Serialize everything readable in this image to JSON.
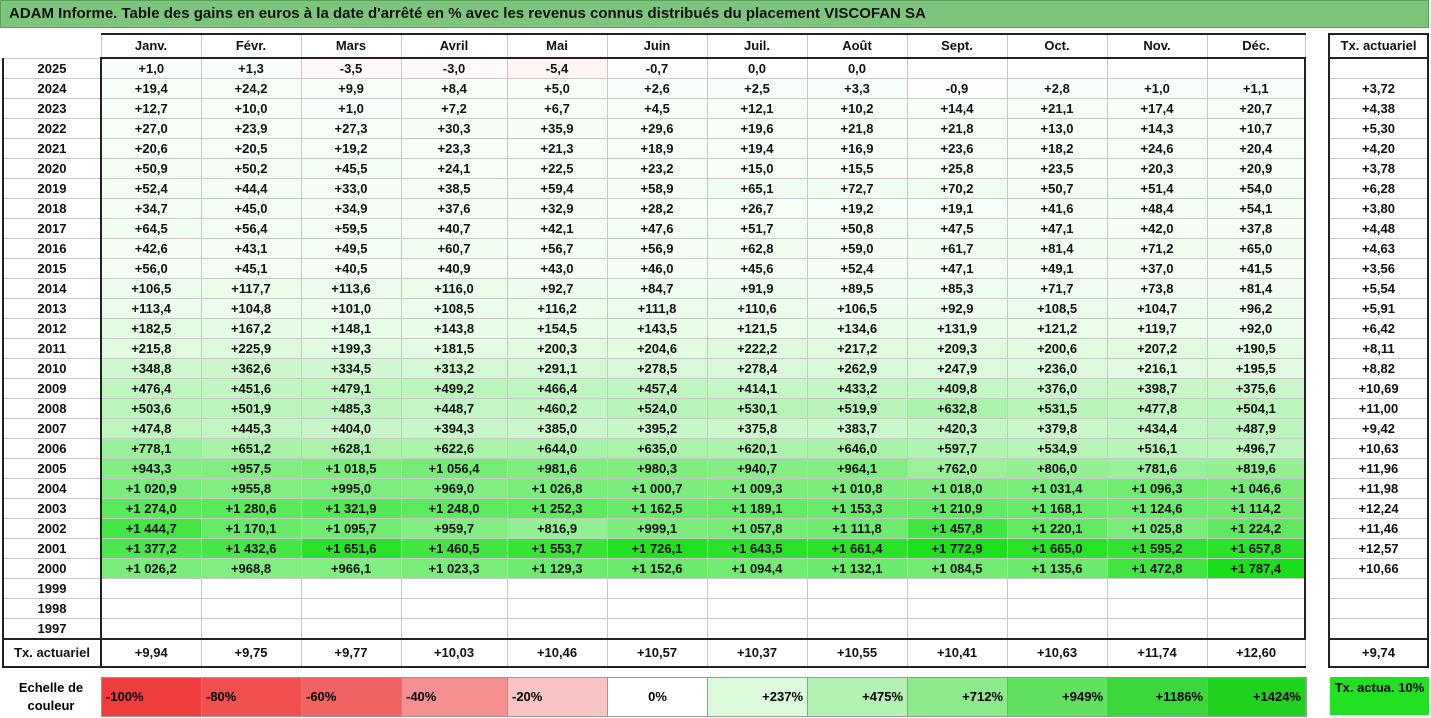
{
  "title": "ADAM Informe. Table des gains en euros à la date d'arrêté en % avec les revenus connus distribués du placement VISCOFAN SA",
  "months": [
    "Janv.",
    "Févr.",
    "Mars",
    "Avril",
    "Mai",
    "Juin",
    "Juil.",
    "Août",
    "Sept.",
    "Oct.",
    "Nov.",
    "Déc."
  ],
  "tx_header": "Tx. actuariel",
  "rows": [
    {
      "year": "2025",
      "values": [
        "+1,0",
        "+1,3",
        "-3,5",
        "-3,0",
        "-5,4",
        "-0,7",
        "0,0",
        "0,0",
        "",
        "",
        "",
        ""
      ],
      "tx": ""
    },
    {
      "year": "2024",
      "values": [
        "+19,4",
        "+24,2",
        "+9,9",
        "+8,4",
        "+5,0",
        "+2,6",
        "+2,5",
        "+3,3",
        "-0,9",
        "+2,8",
        "+1,0",
        "+1,1"
      ],
      "tx": "+3,72"
    },
    {
      "year": "2023",
      "values": [
        "+12,7",
        "+10,0",
        "+1,0",
        "+7,2",
        "+6,7",
        "+4,5",
        "+12,1",
        "+10,2",
        "+14,4",
        "+21,1",
        "+17,4",
        "+20,7"
      ],
      "tx": "+4,38"
    },
    {
      "year": "2022",
      "values": [
        "+27,0",
        "+23,9",
        "+27,3",
        "+30,3",
        "+35,9",
        "+29,6",
        "+19,6",
        "+21,8",
        "+21,8",
        "+13,0",
        "+14,3",
        "+10,7"
      ],
      "tx": "+5,30"
    },
    {
      "year": "2021",
      "values": [
        "+20,6",
        "+20,5",
        "+19,2",
        "+23,3",
        "+21,3",
        "+18,9",
        "+19,4",
        "+16,9",
        "+23,6",
        "+18,2",
        "+24,6",
        "+20,4"
      ],
      "tx": "+4,20"
    },
    {
      "year": "2020",
      "values": [
        "+50,9",
        "+50,2",
        "+45,5",
        "+24,1",
        "+22,5",
        "+23,2",
        "+15,0",
        "+15,5",
        "+25,8",
        "+23,5",
        "+20,3",
        "+20,9"
      ],
      "tx": "+3,78"
    },
    {
      "year": "2019",
      "values": [
        "+52,4",
        "+44,4",
        "+33,0",
        "+38,5",
        "+59,4",
        "+58,9",
        "+65,1",
        "+72,7",
        "+70,2",
        "+50,7",
        "+51,4",
        "+54,0"
      ],
      "tx": "+6,28"
    },
    {
      "year": "2018",
      "values": [
        "+34,7",
        "+45,0",
        "+34,9",
        "+37,6",
        "+32,9",
        "+28,2",
        "+26,7",
        "+19,2",
        "+19,1",
        "+41,6",
        "+48,4",
        "+54,1"
      ],
      "tx": "+3,80"
    },
    {
      "year": "2017",
      "values": [
        "+64,5",
        "+56,4",
        "+59,5",
        "+40,7",
        "+42,1",
        "+47,6",
        "+51,7",
        "+50,8",
        "+47,5",
        "+47,1",
        "+42,0",
        "+37,8"
      ],
      "tx": "+4,48"
    },
    {
      "year": "2016",
      "values": [
        "+42,6",
        "+43,1",
        "+49,5",
        "+60,7",
        "+56,7",
        "+56,9",
        "+62,8",
        "+59,0",
        "+61,7",
        "+81,4",
        "+71,2",
        "+65,0"
      ],
      "tx": "+4,63"
    },
    {
      "year": "2015",
      "values": [
        "+56,0",
        "+45,1",
        "+40,5",
        "+40,9",
        "+43,0",
        "+46,0",
        "+45,6",
        "+52,4",
        "+47,1",
        "+49,1",
        "+37,0",
        "+41,5"
      ],
      "tx": "+3,56"
    },
    {
      "year": "2014",
      "values": [
        "+106,5",
        "+117,7",
        "+113,6",
        "+116,0",
        "+92,7",
        "+84,7",
        "+91,9",
        "+89,5",
        "+85,3",
        "+71,7",
        "+73,8",
        "+81,4"
      ],
      "tx": "+5,54"
    },
    {
      "year": "2013",
      "values": [
        "+113,4",
        "+104,8",
        "+101,0",
        "+108,5",
        "+116,2",
        "+111,8",
        "+110,6",
        "+106,5",
        "+92,9",
        "+108,5",
        "+104,7",
        "+96,2"
      ],
      "tx": "+5,91"
    },
    {
      "year": "2012",
      "values": [
        "+182,5",
        "+167,2",
        "+148,1",
        "+143,8",
        "+154,5",
        "+143,5",
        "+121,5",
        "+134,6",
        "+131,9",
        "+121,2",
        "+119,7",
        "+92,0"
      ],
      "tx": "+6,42"
    },
    {
      "year": "2011",
      "values": [
        "+215,8",
        "+225,9",
        "+199,3",
        "+181,5",
        "+200,3",
        "+204,6",
        "+222,2",
        "+217,2",
        "+209,3",
        "+200,6",
        "+207,2",
        "+190,5"
      ],
      "tx": "+8,11"
    },
    {
      "year": "2010",
      "values": [
        "+348,8",
        "+362,6",
        "+334,5",
        "+313,2",
        "+291,1",
        "+278,5",
        "+278,4",
        "+262,9",
        "+247,9",
        "+236,0",
        "+216,1",
        "+195,5"
      ],
      "tx": "+8,82"
    },
    {
      "year": "2009",
      "values": [
        "+476,4",
        "+451,6",
        "+479,1",
        "+499,2",
        "+466,4",
        "+457,4",
        "+414,1",
        "+433,2",
        "+409,8",
        "+376,0",
        "+398,7",
        "+375,6"
      ],
      "tx": "+10,69"
    },
    {
      "year": "2008",
      "values": [
        "+503,6",
        "+501,9",
        "+485,3",
        "+448,7",
        "+460,2",
        "+524,0",
        "+530,1",
        "+519,9",
        "+632,8",
        "+531,5",
        "+477,8",
        "+504,1"
      ],
      "tx": "+11,00"
    },
    {
      "year": "2007",
      "values": [
        "+474,8",
        "+445,3",
        "+404,0",
        "+394,3",
        "+385,0",
        "+395,2",
        "+375,8",
        "+383,7",
        "+420,3",
        "+379,8",
        "+434,4",
        "+487,9"
      ],
      "tx": "+9,42"
    },
    {
      "year": "2006",
      "values": [
        "+778,1",
        "+651,2",
        "+628,1",
        "+622,6",
        "+644,0",
        "+635,0",
        "+620,1",
        "+646,0",
        "+597,7",
        "+534,9",
        "+516,1",
        "+496,7"
      ],
      "tx": "+10,63"
    },
    {
      "year": "2005",
      "values": [
        "+943,3",
        "+957,5",
        "+1 018,5",
        "+1 056,4",
        "+981,6",
        "+980,3",
        "+940,7",
        "+964,1",
        "+762,0",
        "+806,0",
        "+781,6",
        "+819,6"
      ],
      "tx": "+11,96"
    },
    {
      "year": "2004",
      "values": [
        "+1 020,9",
        "+955,8",
        "+995,0",
        "+969,0",
        "+1 026,8",
        "+1 000,7",
        "+1 009,3",
        "+1 010,8",
        "+1 018,0",
        "+1 031,4",
        "+1 096,3",
        "+1 046,6"
      ],
      "tx": "+11,98"
    },
    {
      "year": "2003",
      "values": [
        "+1 274,0",
        "+1 280,6",
        "+1 321,9",
        "+1 248,0",
        "+1 252,3",
        "+1 162,5",
        "+1 189,1",
        "+1 153,3",
        "+1 210,9",
        "+1 168,1",
        "+1 124,6",
        "+1 114,2"
      ],
      "tx": "+12,24"
    },
    {
      "year": "2002",
      "values": [
        "+1 444,7",
        "+1 170,1",
        "+1 095,7",
        "+959,7",
        "+816,9",
        "+999,1",
        "+1 057,8",
        "+1 111,8",
        "+1 457,8",
        "+1 220,1",
        "+1 025,8",
        "+1 224,2"
      ],
      "tx": "+11,46"
    },
    {
      "year": "2001",
      "values": [
        "+1 377,2",
        "+1 432,6",
        "+1 651,6",
        "+1 460,5",
        "+1 553,7",
        "+1 726,1",
        "+1 643,5",
        "+1 661,4",
        "+1 772,9",
        "+1 665,0",
        "+1 595,2",
        "+1 657,8"
      ],
      "tx": "+12,57"
    },
    {
      "year": "2000",
      "values": [
        "+1 026,2",
        "+968,8",
        "+966,1",
        "+1 023,3",
        "+1 129,3",
        "+1 152,6",
        "+1 094,4",
        "+1 132,1",
        "+1 084,5",
        "+1 135,6",
        "+1 472,8",
        "+1 787,4"
      ],
      "tx": "+10,66"
    },
    {
      "year": "1999",
      "values": [
        "",
        "",
        "",
        "",
        "",
        "",
        "",
        "",
        "",
        "",
        "",
        ""
      ],
      "tx": ""
    },
    {
      "year": "1998",
      "values": [
        "",
        "",
        "",
        "",
        "",
        "",
        "",
        "",
        "",
        "",
        "",
        ""
      ],
      "tx": ""
    },
    {
      "year": "1997",
      "values": [
        "",
        "",
        "",
        "",
        "",
        "",
        "",
        "",
        "",
        "",
        "",
        ""
      ],
      "tx": ""
    }
  ],
  "footer": {
    "label": "Tx. actuariel",
    "values": [
      "+9,94",
      "+9,75",
      "+9,77",
      "+10,03",
      "+10,46",
      "+10,57",
      "+10,37",
      "+10,55",
      "+10,41",
      "+10,63",
      "+11,74",
      "+12,60"
    ],
    "tx": "+9,74"
  },
  "scale": {
    "label": "Echelle de couleur",
    "items": [
      {
        "text": "-100%",
        "color": "#f03c3c",
        "kind": "neg"
      },
      {
        "text": "-80%",
        "color": "#f05050",
        "kind": "neg"
      },
      {
        "text": "-60%",
        "color": "#f26464",
        "kind": "neg"
      },
      {
        "text": "-40%",
        "color": "#f59090",
        "kind": "neg"
      },
      {
        "text": "-20%",
        "color": "#f9c4c4",
        "kind": "neg"
      },
      {
        "text": "0%",
        "color": "#ffffff",
        "kind": "zero"
      },
      {
        "text": "+237%",
        "color": "#dcfadc",
        "kind": "pos"
      },
      {
        "text": "+475%",
        "color": "#b4f2b4",
        "kind": "pos"
      },
      {
        "text": "+712%",
        "color": "#8cea8c",
        "kind": "pos"
      },
      {
        "text": "+949%",
        "color": "#5fe05f",
        "kind": "pos"
      },
      {
        "text": "+1186%",
        "color": "#3ad83a",
        "kind": "pos"
      },
      {
        "text": "+1424%",
        "color": "#1ed21e",
        "kind": "pos"
      }
    ],
    "tx_label": "Tx. actua. 10%"
  }
}
